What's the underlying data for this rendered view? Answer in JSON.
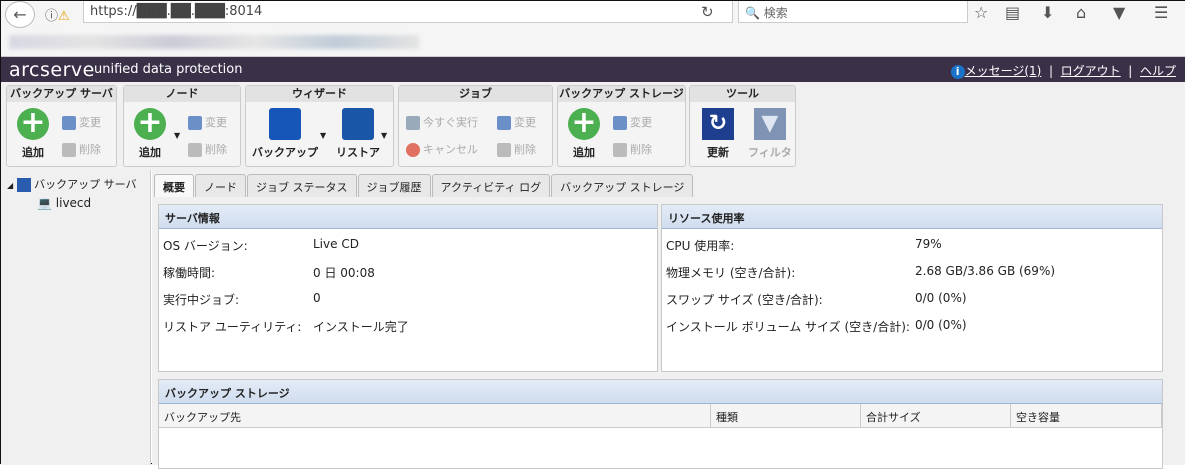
{
  "browser": {
    "url": "https://███.██.███:8014",
    "search_placeholder": "検索"
  },
  "app": {
    "logo": "arcserve",
    "product": "unified data protection",
    "links": {
      "messages": "メッセージ(1)",
      "logout": "ログアウト",
      "help": "ヘルプ"
    }
  },
  "toolbar": {
    "backup_server": {
      "title": "バックアップ サーバ",
      "add": "追加",
      "modify": "変更",
      "delete": "削除"
    },
    "node": {
      "title": "ノード",
      "add": "追加",
      "modify": "変更",
      "delete": "削除"
    },
    "wizard": {
      "title": "ウィザード",
      "backup": "バックアップ",
      "restore": "リストア"
    },
    "job": {
      "title": "ジョブ",
      "run_now": "今すぐ実行",
      "cancel": "キャンセル",
      "modify": "変更",
      "delete": "削除"
    },
    "storage": {
      "title": "バックアップ ストレージ",
      "add": "追加",
      "modify": "変更",
      "delete": "削除"
    },
    "tools": {
      "title": "ツール",
      "refresh": "更新",
      "filter": "フィルタ"
    }
  },
  "tree": {
    "root": "バックアップ サーバ",
    "child": "livecd"
  },
  "tabs": [
    "概要",
    "ノード",
    "ジョブ ステータス",
    "ジョブ履歴",
    "アクティビティ ログ",
    "バックアップ ストレージ"
  ],
  "server_info": {
    "title": "サーバ情報",
    "rows": [
      [
        "OS バージョン:",
        "Live CD"
      ],
      [
        "稼働時間:",
        "0 日 00:08"
      ],
      [
        "実行中ジョブ:",
        "0"
      ],
      [
        "リストア ユーティリティ:",
        "インストール完了"
      ]
    ]
  },
  "resources": {
    "title": "リソース使用率",
    "rows": [
      [
        "CPU 使用率:",
        "79%"
      ],
      [
        "物理メモリ (空き/合計):",
        "2.68 GB/3.86 GB (69%)"
      ],
      [
        "スワップ サイズ (空き/合計):",
        "0/0 (0%)"
      ],
      [
        "インストール ボリューム サイズ (空き/合計):",
        "0/0 (0%)"
      ]
    ]
  },
  "storage_panel": {
    "title": "バックアップ ストレージ",
    "columns": [
      "バックアップ先",
      "種類",
      "合計サイズ",
      "空き容量"
    ]
  }
}
